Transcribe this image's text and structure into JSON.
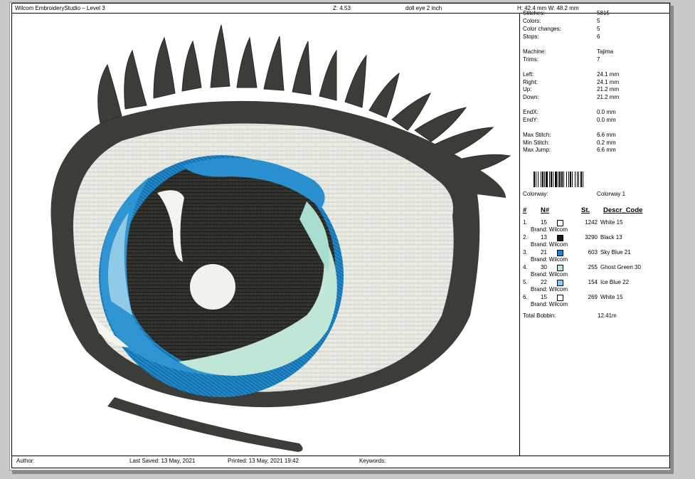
{
  "header": {
    "app_title": "Wilcom EmbroideryStudio – Level 3",
    "zoom": "Z: 4.53",
    "design_name": "doll eye 2 inch",
    "dimensions": "H: 42.4 mm   W: 48.2 mm"
  },
  "stats": [
    {
      "label": "Stitches:",
      "value": "5815"
    },
    {
      "label": "Colors:",
      "value": "5"
    },
    {
      "label": "Color changes:",
      "value": "5"
    },
    {
      "label": "Stops:",
      "value": "6"
    },
    {
      "label": "Machine:",
      "value": "Tajima"
    },
    {
      "label": "Trims:",
      "value": "7"
    },
    {
      "label": "Left:",
      "value": "24.1 mm"
    },
    {
      "label": "Right:",
      "value": "24.1 mm"
    },
    {
      "label": "Up:",
      "value": "21.2 mm"
    },
    {
      "label": "Down:",
      "value": "21.2 mm"
    },
    {
      "label": "EndX:",
      "value": "0.0 mm"
    },
    {
      "label": "EndY:",
      "value": "0.0 mm"
    },
    {
      "label": "Max Stitch:",
      "value": "6.6 mm"
    },
    {
      "label": "Min Stitch:",
      "value": "0.2 mm"
    },
    {
      "label": "Max Jump:",
      "value": "6.6 mm"
    }
  ],
  "colorway": {
    "label": "Colorway:",
    "value": "Colorway 1"
  },
  "table": {
    "headers": {
      "num": "#",
      "n": "N#",
      "st": "St.",
      "descr": "Descr_Code"
    },
    "rows": [
      {
        "num": "1.",
        "n": "15",
        "color": "#ffffff",
        "st": "1242",
        "descr": "White 15",
        "brand": "Brand: Wilcom"
      },
      {
        "num": "2.",
        "n": "13",
        "color": "#1a1a1a",
        "st": "3290",
        "descr": "Black 13",
        "brand": "Brand: Wilcom"
      },
      {
        "num": "3.",
        "n": "21",
        "color": "#1f86c7",
        "st": "603",
        "descr": "Sky Blue 21",
        "brand": "Brand: Wilcom"
      },
      {
        "num": "4.",
        "n": "30",
        "color": "#bfe6d6",
        "st": "255",
        "descr": "Ghost Green 30",
        "brand": "Brand: Wilcom"
      },
      {
        "num": "5.",
        "n": "22",
        "color": "#8fcbe6",
        "st": "154",
        "descr": "Ice Blue 22",
        "brand": "Brand: Wilcom"
      },
      {
        "num": "6.",
        "n": "15",
        "color": "#ffffff",
        "st": "269",
        "descr": "White 15",
        "brand": "Brand: Wilcom"
      }
    ],
    "total_label": "Total Bobbin:",
    "total_value": "12.41m"
  },
  "footer": {
    "author": "Author:",
    "last_saved": "Last Saved: 13 May, 2021",
    "printed": "Printed: 13 May, 2021 19:42",
    "keywords": "Keywords:"
  },
  "colors": {
    "outline": "#3c3c38",
    "sclera": "#e6e8e0",
    "pupil": "#2e2e2c",
    "iris": "#1f86c7",
    "ghost_green": "#bfe6d6",
    "ice_blue": "#8fcbe6",
    "white": "#ffffff"
  }
}
